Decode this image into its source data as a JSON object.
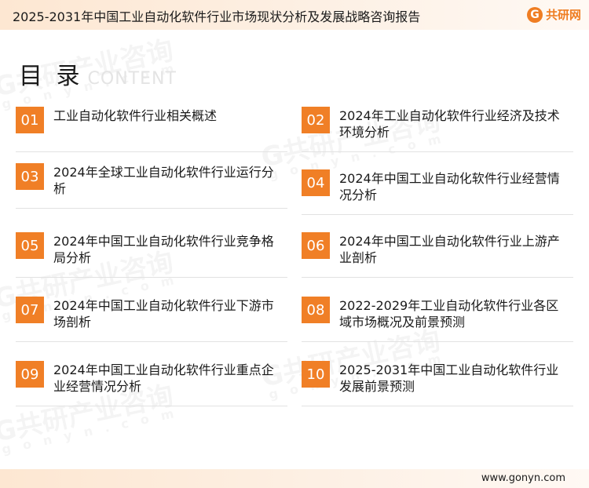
{
  "header": {
    "title": "2025-2031年中国工业自动化软件行业市场现状分析及发展战略咨询报告",
    "logo_mark": "G",
    "logo_text": "共研网"
  },
  "toc": {
    "title_cn": "目 录",
    "title_en": "CONTENT"
  },
  "watermark": {
    "brand": "G共研产业咨询",
    "domain": "g o n y n . c o m"
  },
  "items": [
    {
      "num": "01",
      "text": "工业自动化软件行业相关概述"
    },
    {
      "num": "02",
      "text": "2024年工业自动化软件行业经济及技术环境分析"
    },
    {
      "num": "03",
      "text": "2024年全球工业自动化软件行业运行分析"
    },
    {
      "num": "04",
      "text": "2024年中国工业自动化软件行业经营情况分析"
    },
    {
      "num": "05",
      "text": "2024年中国工业自动化软件行业竞争格局分析"
    },
    {
      "num": "06",
      "text": "2024年中国工业自动化软件行业上游产业剖析"
    },
    {
      "num": "07",
      "text": "2024年中国工业自动化软件行业下游市场剖析"
    },
    {
      "num": "08",
      "text": "2022-2029年工业自动化软件行业各区域市场概况及前景预测"
    },
    {
      "num": "09",
      "text": "2024年中国工业自动化软件行业重点企业经营情况分析"
    },
    {
      "num": "10",
      "text": "2025-2031年中国工业自动化软件行业发展前景预测"
    }
  ],
  "footer": {
    "url": "www.gonyn.com"
  },
  "colors": {
    "accent": "#f07f26",
    "header_bg": "#fde7d2"
  }
}
